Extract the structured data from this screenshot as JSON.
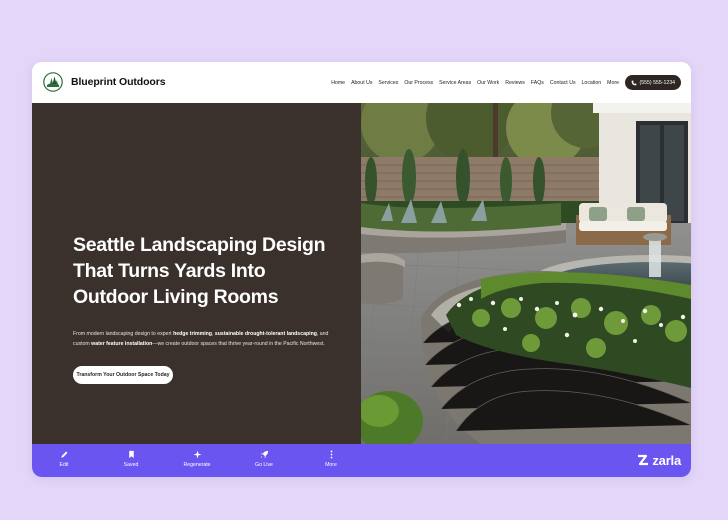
{
  "site": {
    "brand": "Blueprint Outdoors",
    "logo_icon": "pine-tree-logo-icon"
  },
  "nav": {
    "items": [
      {
        "label": "Home"
      },
      {
        "label": "About Us"
      },
      {
        "label": "Services"
      },
      {
        "label": "Our Process"
      },
      {
        "label": "Service Areas"
      },
      {
        "label": "Our Work"
      },
      {
        "label": "Reviews"
      },
      {
        "label": "FAQs"
      },
      {
        "label": "Contact Us"
      },
      {
        "label": "Location"
      },
      {
        "label": "More"
      }
    ],
    "phone": "(555) 555-1234",
    "phone_icon": "phone-icon"
  },
  "hero": {
    "title": "Seattle Landscaping Design That Turns Yards Into Outdoor Living Rooms",
    "subtitle_pre": "From modern landscaping design to expert ",
    "subtitle_bold_1": "hedge trimming",
    "subtitle_mid_1": ", ",
    "subtitle_bold_2": "sustainable drought-tolerant landscaping",
    "subtitle_mid_2": ", and custom ",
    "subtitle_bold_3": "water feature installation",
    "subtitle_post": "—we create outdoor spaces that thrive year-round in the Pacific Northwest.",
    "cta": "Transform Your Outdoor Space Today",
    "image_description_icon": "garden-patio-photo"
  },
  "toolbar": {
    "items": [
      {
        "label": "Edit",
        "icon": "pencil-icon"
      },
      {
        "label": "Saved",
        "icon": "bookmark-icon"
      },
      {
        "label": "Regenerate",
        "icon": "sparkle-icon"
      },
      {
        "label": "Go Live",
        "icon": "rocket-icon"
      },
      {
        "label": "More",
        "icon": "more-vertical-icon"
      }
    ],
    "brand": "zarla"
  },
  "colors": {
    "page_bg": "#e3d6f8",
    "hero_left_bg": "#3a312c",
    "toolbar_bg": "#6a55f1",
    "phone_button_bg": "#2e2622"
  }
}
